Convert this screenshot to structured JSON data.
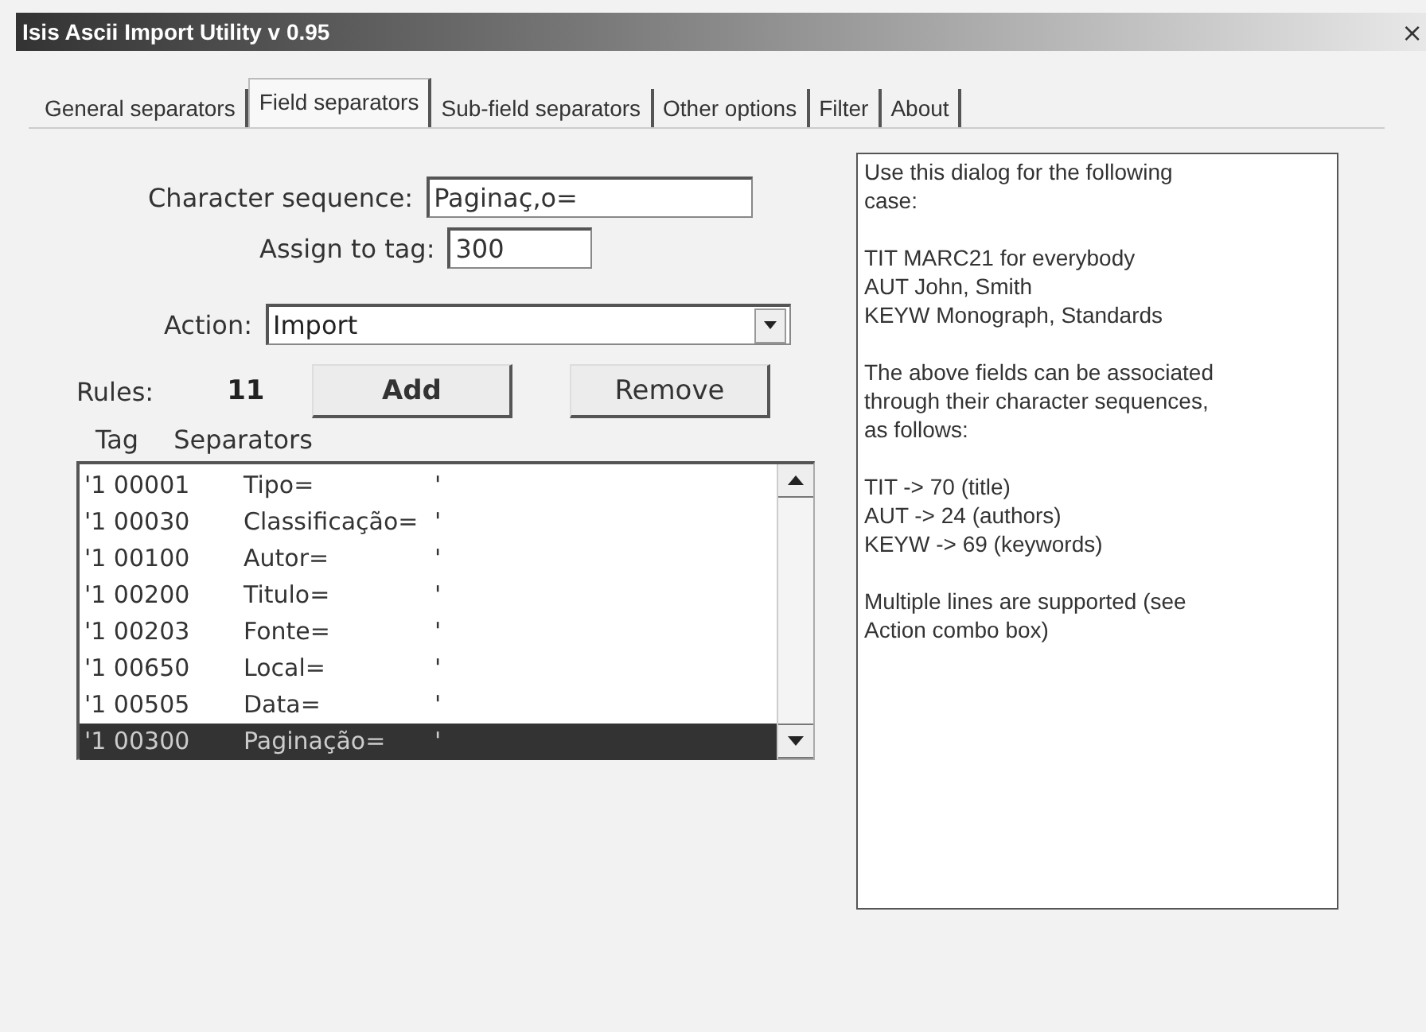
{
  "window": {
    "title": "Isis Ascii Import Utility v 0.95",
    "close": "×"
  },
  "tabs": [
    {
      "label": "General separators",
      "selected": false
    },
    {
      "label": "Field separators",
      "selected": true
    },
    {
      "label": "Sub-field separators",
      "selected": false
    },
    {
      "label": "Other options",
      "selected": false
    },
    {
      "label": "Filter",
      "selected": false
    },
    {
      "label": "About",
      "selected": false
    }
  ],
  "form": {
    "character_sequence": {
      "label": "Character sequence:",
      "value": "Paginaç‚o="
    },
    "assign_to_tag": {
      "label": "Assign to tag:",
      "value": "300"
    },
    "action": {
      "label": "Action:",
      "value": "Import"
    }
  },
  "rules": {
    "label": "Rules:",
    "count": "11",
    "buttons": [
      "Add",
      "Remove"
    ]
  },
  "list": {
    "columns": [
      "Tag",
      "Separators"
    ],
    "rows": [
      {
        "tag": "'1 00001",
        "separator": "Tipo=",
        "quote": "'",
        "selected": false
      },
      {
        "tag": "'1 00030",
        "separator": "Classificação=",
        "quote": "'",
        "selected": false
      },
      {
        "tag": "'1 00100",
        "separator": "Autor=",
        "quote": "'",
        "selected": false
      },
      {
        "tag": "'1 00200",
        "separator": "Titulo=",
        "quote": "'",
        "selected": false
      },
      {
        "tag": "'1 00203",
        "separator": "Fonte=",
        "quote": "'",
        "selected": false
      },
      {
        "tag": "'1 00650",
        "separator": "Local=",
        "quote": "'",
        "selected": false
      },
      {
        "tag": "'1 00505",
        "separator": "Data=",
        "quote": "'",
        "selected": false
      },
      {
        "tag": "'1 00300",
        "separator": "Paginação=",
        "quote": "'",
        "selected": true
      }
    ]
  },
  "help": [
    [
      "Use this dialog for the following",
      "case:"
    ],
    [
      "TIT MARC21 for everybody",
      "AUT John, Smith",
      "KEYW Monograph, Standards"
    ],
    [
      "The above fields can be associated",
      "through their character sequences,",
      "as follows:"
    ],
    [
      "TIT -> 70 (title)",
      "AUT -> 24 (authors)",
      "KEYW -> 69 (keywords)"
    ],
    [
      "Multiple lines are supported (see",
      "Action combo box)"
    ]
  ]
}
